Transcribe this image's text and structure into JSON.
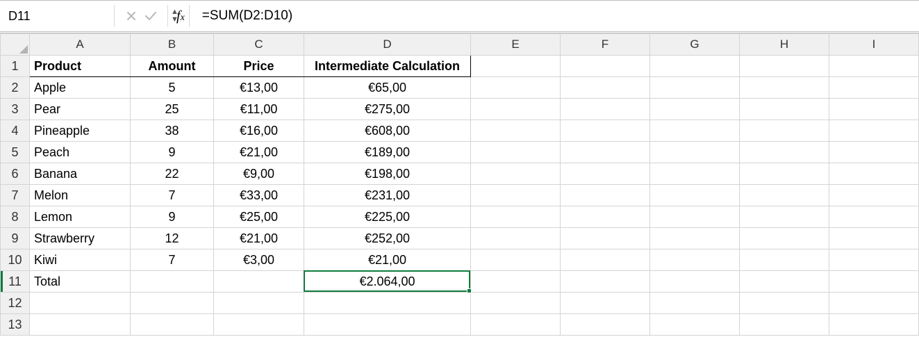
{
  "formula_bar": {
    "cell_reference": "D11",
    "formula": "=SUM(D2:D10)"
  },
  "columns": [
    "A",
    "B",
    "C",
    "D",
    "E",
    "F",
    "G",
    "H",
    "I"
  ],
  "row_numbers": [
    "1",
    "2",
    "3",
    "4",
    "5",
    "6",
    "7",
    "8",
    "9",
    "10",
    "11",
    "12",
    "13"
  ],
  "header_row": {
    "A": "Product",
    "B": "Amount",
    "C": "Price",
    "D": "Intermediate Calculation"
  },
  "rows": [
    {
      "product": "Apple",
      "amount": "5",
      "price": "€13,00",
      "calc": "€65,00"
    },
    {
      "product": "Pear",
      "amount": "25",
      "price": "€11,00",
      "calc": "€275,00"
    },
    {
      "product": "Pineapple",
      "amount": "38",
      "price": "€16,00",
      "calc": "€608,00"
    },
    {
      "product": "Peach",
      "amount": "9",
      "price": "€21,00",
      "calc": "€189,00"
    },
    {
      "product": "Banana",
      "amount": "22",
      "price": "€9,00",
      "calc": "€198,00"
    },
    {
      "product": "Melon",
      "amount": "7",
      "price": "€33,00",
      "calc": "€231,00"
    },
    {
      "product": "Lemon",
      "amount": "9",
      "price": "€25,00",
      "calc": "€225,00"
    },
    {
      "product": "Strawberry",
      "amount": "12",
      "price": "€21,00",
      "calc": "€252,00"
    },
    {
      "product": "Kiwi",
      "amount": "7",
      "price": "€3,00",
      "calc": "€21,00"
    }
  ],
  "total_row": {
    "label": "Total",
    "calc": "€2.064,00"
  },
  "selected_cell": "D11"
}
